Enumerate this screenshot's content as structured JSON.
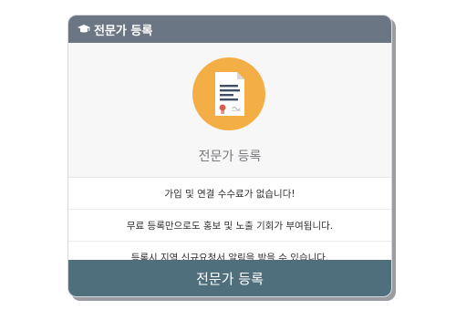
{
  "header": {
    "icon": "graduation-cap-icon",
    "title": "전문가 등록"
  },
  "hero": {
    "icon": "certificate-document-icon",
    "title": "전문가 등록"
  },
  "benefits": [
    "가입 및 연결 수수료가 없습니다!",
    "무료 등록만으로도 홍보 및 노출 기회가 부여됩니다.",
    "등록시 지역 신규요청서 알림을 받을 수 있습니다."
  ],
  "cta": {
    "label": "전문가 등록"
  },
  "colors": {
    "header_bg": "#6b7685",
    "circle": "#f3ae45",
    "button_bg": "#4f6f7d"
  }
}
